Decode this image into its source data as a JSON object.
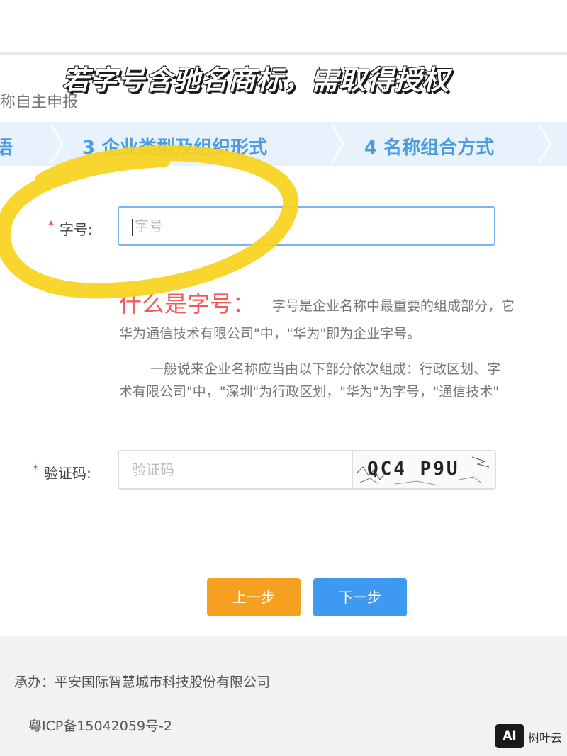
{
  "overlay": {
    "title": "若字号含驰名商标，需取得授权"
  },
  "page": {
    "heading": "称自主申报"
  },
  "steps": [
    {
      "label": "语"
    },
    {
      "label": "3 企业类型及组织形式"
    },
    {
      "label": "4 名称组合方式"
    }
  ],
  "form": {
    "brand_label": "字号:",
    "brand_placeholder": "字号",
    "captcha_label": "验证码:",
    "captcha_placeholder": "验证码",
    "captcha_code": "QC4 P9U"
  },
  "info": {
    "title": "什么是字号：",
    "line1": "字号是企业名称中最重要的组成部分，它",
    "line2": "华为通信技术有限公司\"中，\"华为\"即为企业字号。",
    "line3": "一般说来企业名称应当由以下部分依次组成：行政区划、字",
    "line4": "术有限公司\"中，\"深圳\"为行政区划，\"华为\"为字号，\"通信技术\""
  },
  "buttons": {
    "prev": "上一步",
    "next": "下一步"
  },
  "footer": {
    "organizer": "承办：平安国际智慧城市科技股份有限公司",
    "icp": "粤ICP备15042059号-2"
  },
  "watermark": {
    "badge": "AI",
    "text": "树叶云"
  },
  "colors": {
    "accent_blue": "#3d9af0",
    "prev_orange": "#f5a020",
    "required_red": "#e03030",
    "highlight_yellow": "#f7d21c"
  }
}
